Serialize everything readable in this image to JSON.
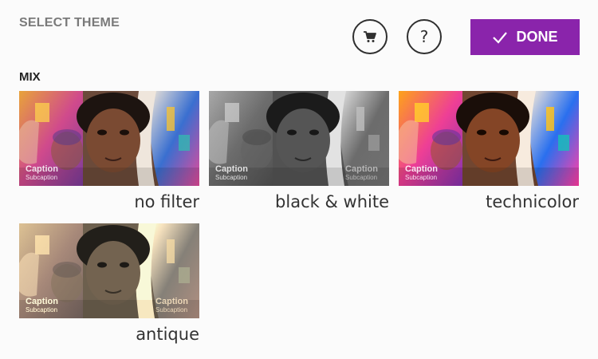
{
  "header": {
    "title": "SELECT THEME",
    "done_label": "DONE",
    "help_label": "?"
  },
  "section": {
    "label": "MIX"
  },
  "themes": [
    {
      "name": "no filter",
      "caption": "Caption",
      "subcaption": "Subcaption"
    },
    {
      "name": "black & white",
      "caption": "Caption",
      "subcaption": "Subcaption"
    },
    {
      "name": "technicolor",
      "caption": "Caption",
      "subcaption": "Subcaption"
    },
    {
      "name": "antique",
      "caption": "Caption",
      "subcaption": "Subcaption"
    }
  ],
  "colors": {
    "accent": "#8a24ab",
    "title_gray": "#7a7a7a",
    "background": "#fbfbfb"
  }
}
